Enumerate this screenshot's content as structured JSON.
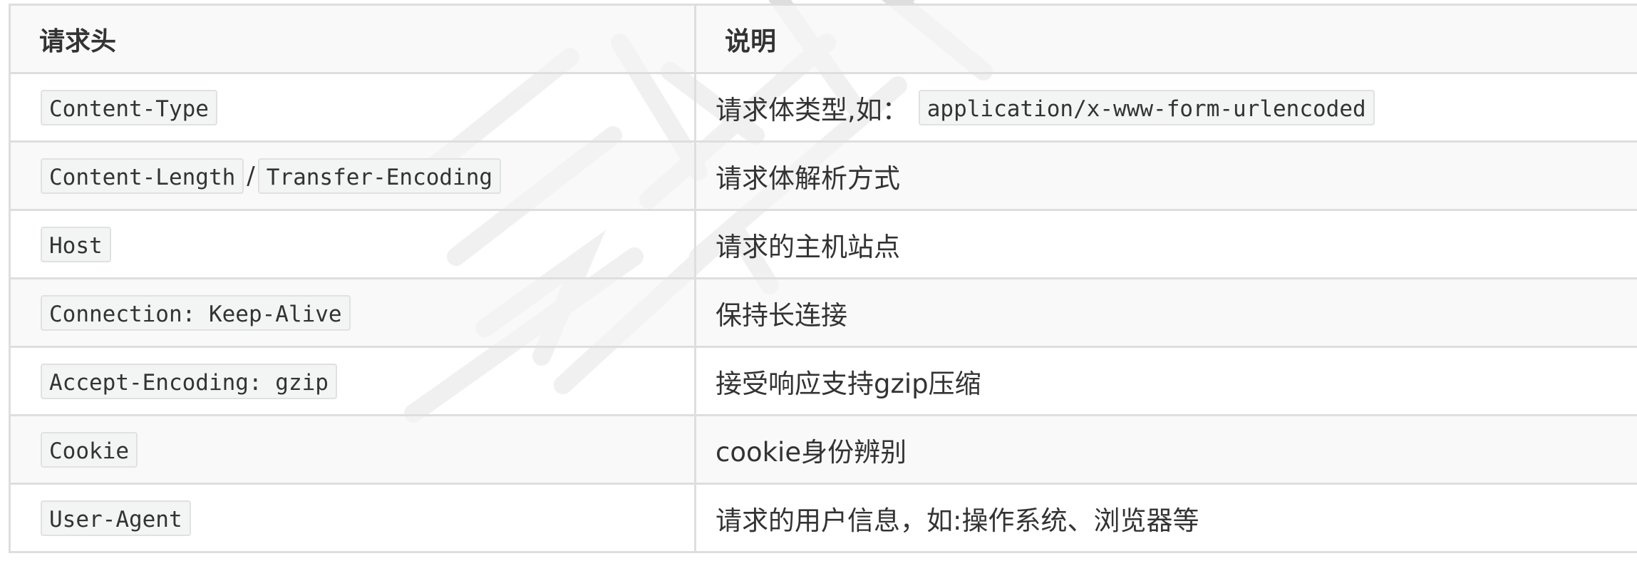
{
  "table": {
    "columns": [
      "请求头",
      "说明"
    ],
    "rows": [
      {
        "header": "Content-Type",
        "description": "请求体类型,如：",
        "description_code": "application/x-www-form-urlencoded"
      },
      {
        "header": "Content-Length",
        "separator": "/",
        "header_alt": "Transfer-Encoding",
        "description": "请求体解析方式"
      },
      {
        "header": "Host",
        "description": "请求的主机站点"
      },
      {
        "header": "Connection: Keep-Alive",
        "description": "保持长连接"
      },
      {
        "header": "Accept-Encoding: gzip",
        "description": "接受响应支持gzip压缩"
      },
      {
        "header": "Cookie",
        "description": "cookie身份辨别"
      },
      {
        "header": "User-Agent",
        "description": "请求的用户信息，如:操作系统、浏览器等"
      }
    ]
  },
  "colors": {
    "border": "#dedede",
    "header_bg": "#f8f8f8",
    "stripe_bg": "#f8f8f8",
    "code_bg": "#f3f4f4",
    "code_border": "#e1e1e1",
    "text": "#333333",
    "watermark": "#d9d9d9"
  }
}
